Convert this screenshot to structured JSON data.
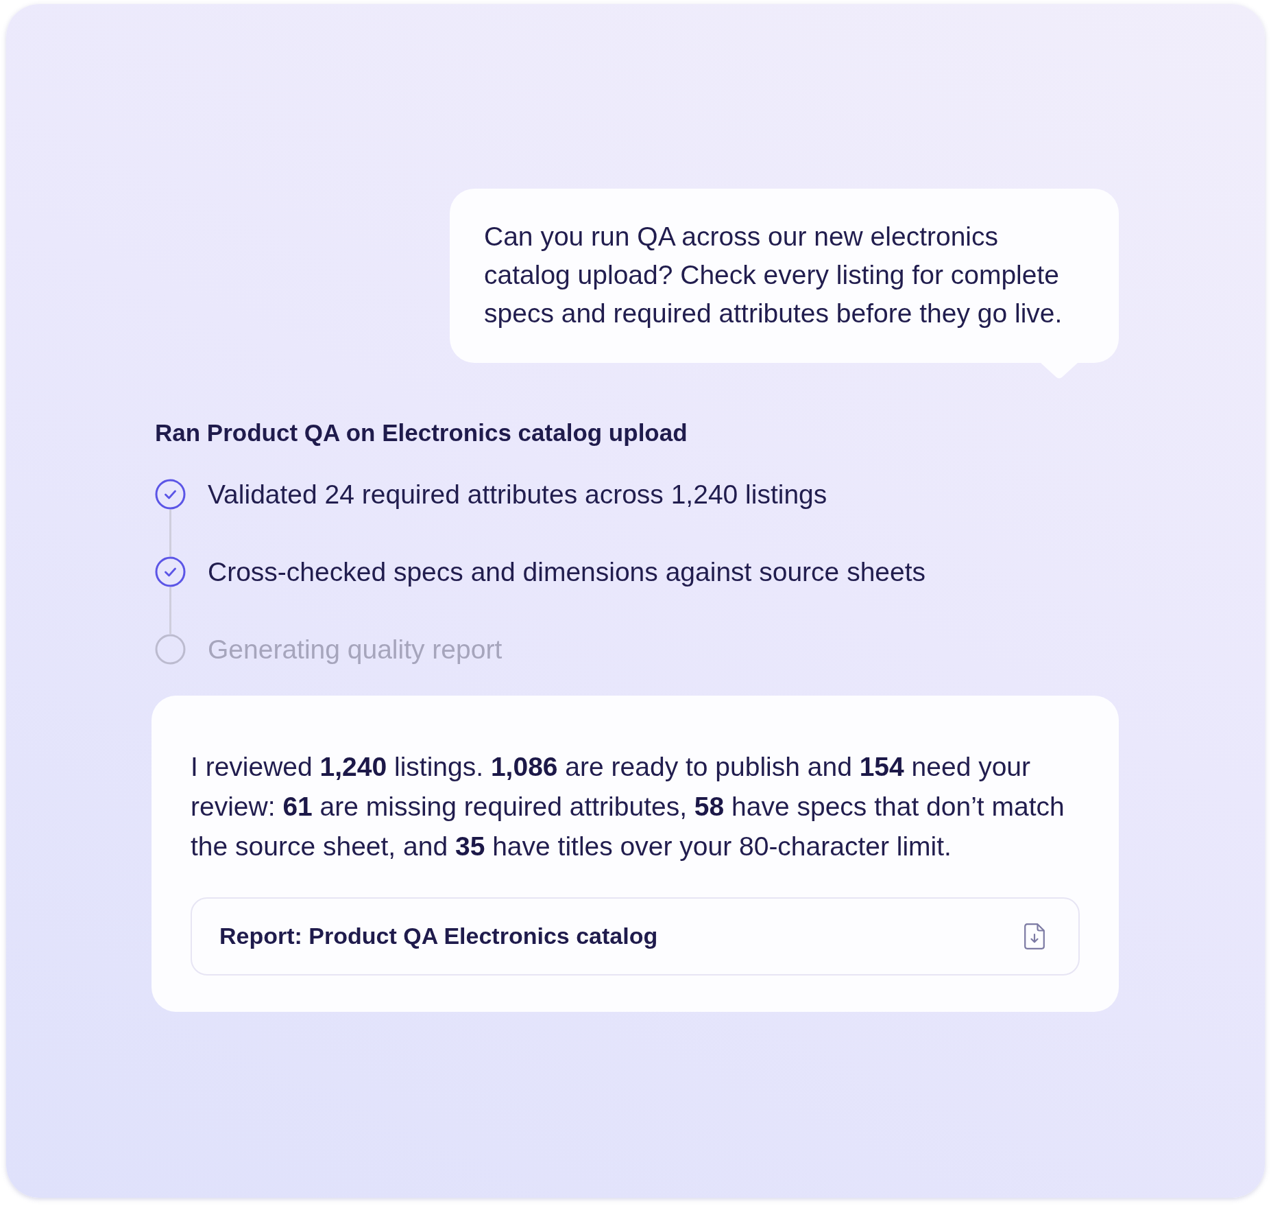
{
  "user_message": {
    "text": "Can you run QA across our new electronics catalog upload? Check every listing for complete specs and required attributes before they go live."
  },
  "task": {
    "title": "Ran Product QA on Electronics catalog upload",
    "steps": [
      {
        "label": "Validated 24 required attributes across 1,240 listings",
        "completed": true
      },
      {
        "label": "Cross-checked specs and dimensions against source sheets",
        "completed": true
      },
      {
        "label": "Generating quality report",
        "completed": false
      }
    ]
  },
  "reply": {
    "text": "I reviewed **1,240** listings. **1,086** are ready to publish and **154** need your review: **61** are missing required attributes, **58** have specs that don’t match the source sheet, and **35** have titles over your 80-character limit.",
    "attachment": {
      "label": "Report: Product QA Electronics catalog"
    }
  }
}
